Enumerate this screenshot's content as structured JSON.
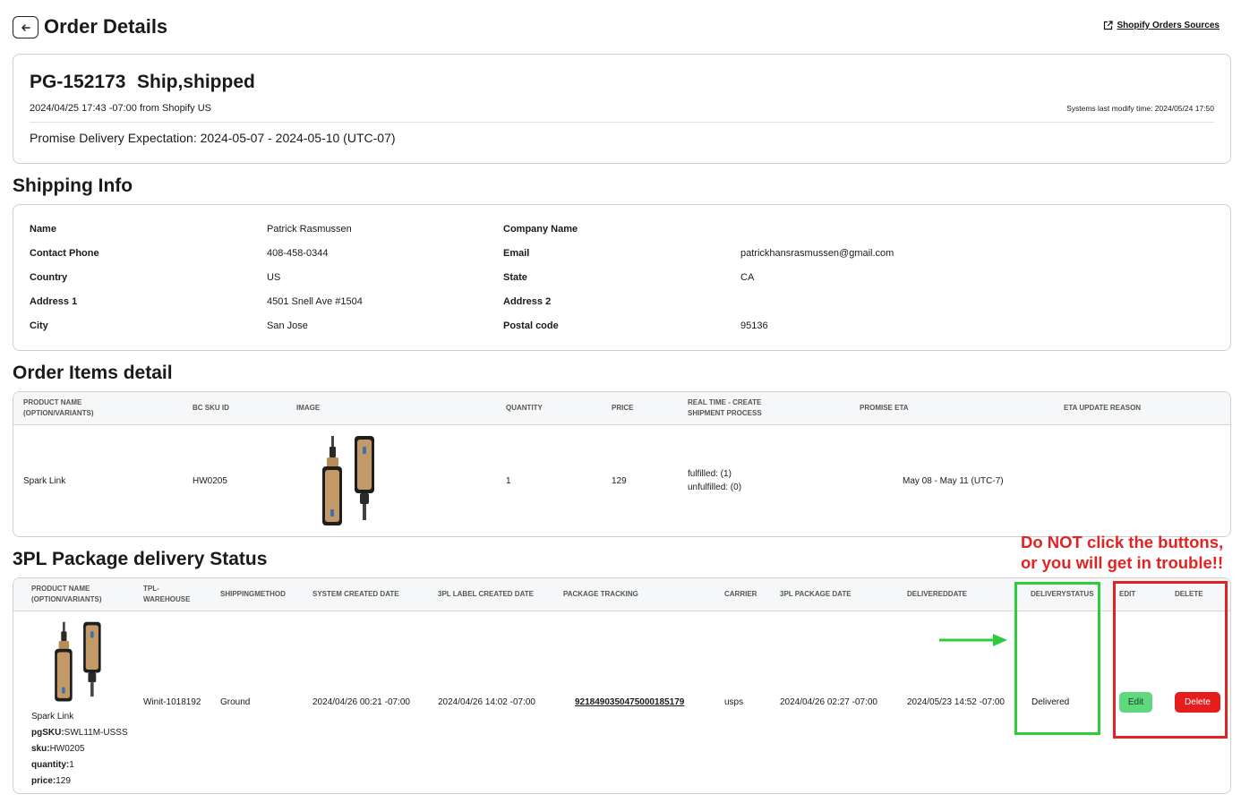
{
  "header": {
    "title": "Order Details",
    "sources_link": "Shopify Orders Sources"
  },
  "order": {
    "id": "PG-152173",
    "status": "Ship,shipped",
    "created": "2024/04/25 17:43 -07:00 from Shopify US",
    "modify_time": "Systems last modify time: 2024/05/24 17:50",
    "promise": "Promise Delivery Expectation: 2024-05-07 - 2024-05-10 (UTC-07)"
  },
  "shipping": {
    "title": "Shipping Info",
    "labels": {
      "name": "Name",
      "company": "Company Name",
      "phone": "Contact Phone",
      "email": "Email",
      "country": "Country",
      "state": "State",
      "address1": "Address 1",
      "address2": "Address 2",
      "city": "City",
      "postal": "Postal code"
    },
    "values": {
      "name": "Patrick Rasmussen",
      "company": "",
      "phone": "408-458-0344",
      "email": "patrickhansrasmussen@gmail.com",
      "country": "US",
      "state": "CA",
      "address1": "4501 Snell Ave #1504",
      "address2": "",
      "city": "San Jose",
      "postal": "95136"
    }
  },
  "items": {
    "title": "Order Items detail",
    "columns": {
      "product": "PRODUCT NAME (OPTION/VARIANTS)",
      "sku": "BC SKU ID",
      "image": "IMAGE",
      "qty": "QUANTITY",
      "price": "PRICE",
      "realtime": "REAL TIME - CREATE SHIPMENT PROCESS",
      "eta": "PROMISE ETA",
      "reason": "ETA UPDATE REASON"
    },
    "row": {
      "product": "Spark Link",
      "sku": "HW0205",
      "qty": "1",
      "price": "129",
      "fulfilled": "fulfilled: (1)",
      "unfulfilled": "unfulfilled: (0)",
      "eta": "May 08 - May 11 (UTC-7)"
    }
  },
  "packages": {
    "title": "3PL Package delivery Status",
    "columns": {
      "product": "PRODUCT NAME (OPTION/VARIANTS)",
      "warehouse": "TPL-WAREHOUSE",
      "method": "SHIPPINGMETHOD",
      "sys_created": "SYSTEM CREATED DATE",
      "label_created": "3PL LABEL CREATED DATE",
      "tracking": "PACKAGE TRACKING",
      "carrier": "CARRIER",
      "pkg_date": "3PL PACKAGE DATE",
      "delivered_date": "DELIVEREDDATE",
      "delivery_status": "DELIVERYSTATUS",
      "edit": "EDIT",
      "delete": "DELETE"
    },
    "row": {
      "product": "Spark Link",
      "pgsku_label": "pgSKU:",
      "pgsku": "SWL11M-USSS",
      "sku_label": "sku:",
      "sku": "HW0205",
      "qty_label": "quantity:",
      "qty": "1",
      "price_label": "price:",
      "price": "129",
      "warehouse": "Winit-1018192",
      "method": "Ground",
      "sys_created": "2024/04/26 00:21 -07:00",
      "label_created": "2024/04/26 14:02 -07:00",
      "tracking": "9218490350475000185179",
      "carrier": "usps",
      "pkg_date": "2024/04/26 02:27 -07:00",
      "delivered_date": "2024/05/23 14:52 -07:00",
      "delivery_status": "Delivered",
      "edit_label": "Edit",
      "delete_label": "Delete"
    }
  },
  "warning": {
    "line1": "Do NOT click the buttons,",
    "line2": "or you will get in trouble!!"
  },
  "colors": {
    "edit_button": "#5fd87e",
    "delete_button": "#e51d1d",
    "warning_text": "#e32323",
    "highlight_green": "#2ecc3c",
    "highlight_red": "#e02424"
  }
}
